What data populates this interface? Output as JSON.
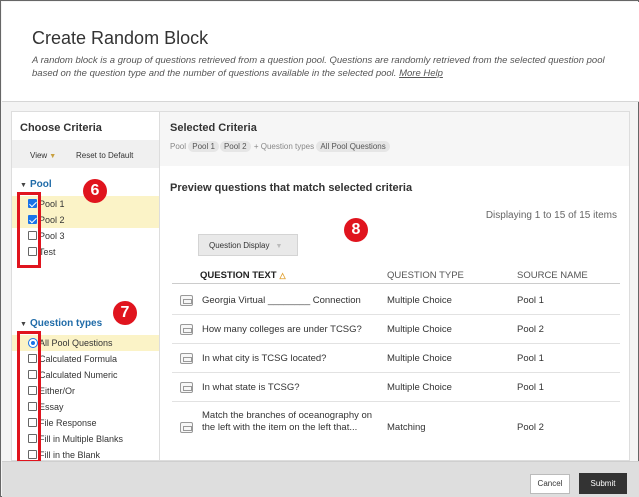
{
  "header": {
    "title": "Create Random Block",
    "description": "A random block is a group of questions retrieved from a question pool. Questions are randomly retrieved from the selected question pool based on the question type and the number of questions available in the selected pool.",
    "help_link": "More Help"
  },
  "left": {
    "title": "Choose Criteria",
    "view_label": "View",
    "reset_label": "Reset to Default",
    "pool": {
      "title": "Pool",
      "items": [
        {
          "label": "Pool 1",
          "checked": true
        },
        {
          "label": "Pool 2",
          "checked": true
        },
        {
          "label": "Pool 3",
          "checked": false
        },
        {
          "label": "Test",
          "checked": false
        }
      ]
    },
    "qtypes": {
      "title": "Question types",
      "items": [
        {
          "label": "All Pool Questions",
          "selected": true
        },
        {
          "label": "Calculated Formula"
        },
        {
          "label": "Calculated Numeric"
        },
        {
          "label": "Either/Or"
        },
        {
          "label": "Essay"
        },
        {
          "label": "File Response"
        },
        {
          "label": "Fill in Multiple Blanks"
        },
        {
          "label": "Fill in the Blank"
        }
      ]
    }
  },
  "right": {
    "title": "Selected Criteria",
    "pool_label": "Pool",
    "pool_chips": [
      "Pool 1",
      "Pool 2"
    ],
    "qtypes_label": "+ Question types",
    "qtype_chip": "All Pool Questions",
    "preview_title": "Preview questions that match selected criteria",
    "display_count": "Displaying 1 to 15 of 15 items",
    "question_display_label": "Question Display",
    "columns": {
      "text": "QUESTION TEXT",
      "type": "QUESTION TYPE",
      "source": "SOURCE NAME"
    },
    "rows": [
      {
        "text": "Georgia Virtual ________ Connection",
        "type": "Multiple Choice",
        "source": "Pool 1"
      },
      {
        "text": "How many colleges are under TCSG?",
        "type": "Multiple Choice",
        "source": "Pool 2"
      },
      {
        "text": "In what city is TCSG located?",
        "type": "Multiple Choice",
        "source": "Pool 1"
      },
      {
        "text": "In what state is TCSG?",
        "type": "Multiple Choice",
        "source": "Pool 1"
      },
      {
        "text": "Match the branches of oceanography on the left with the item on the left that...",
        "type": "Matching",
        "source": "Pool 2"
      }
    ]
  },
  "annotations": {
    "badge_pool": "6",
    "badge_qtypes": "7",
    "badge_table": "8"
  },
  "footer": {
    "cancel_label": "Cancel",
    "submit_label": "Submit"
  }
}
